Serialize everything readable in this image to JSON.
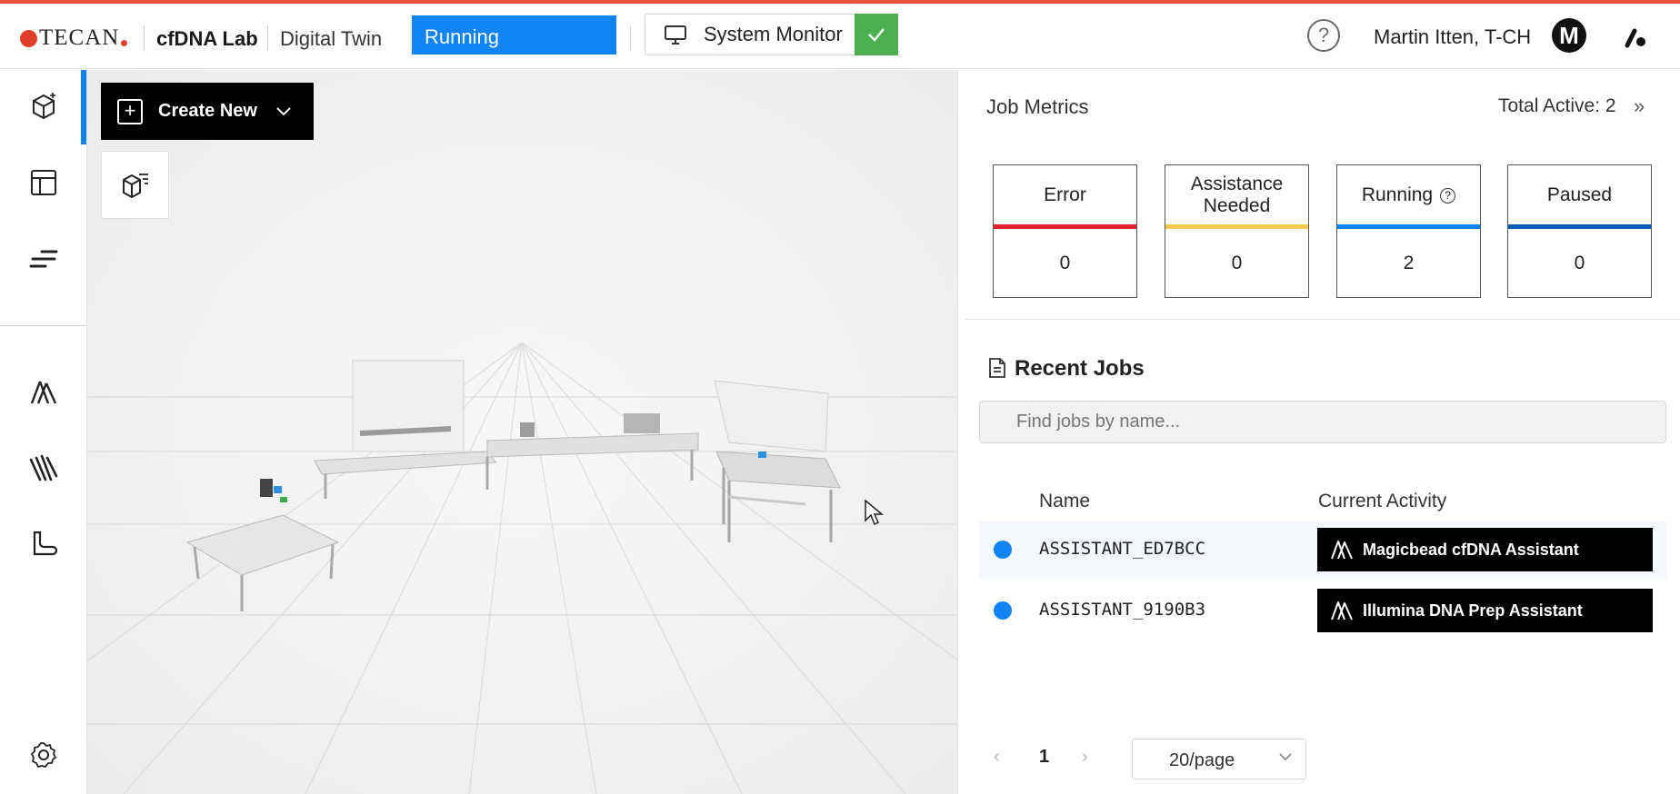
{
  "header": {
    "logo_text": "TECAN",
    "lab_name": "cfDNA Lab",
    "view_name": "Digital Twin",
    "status": "Running",
    "system_monitor_label": "System Monitor",
    "help_glyph": "?",
    "user_name": "Martin Itten, T-CH",
    "avatar_initial": "M"
  },
  "sidebar": {
    "items": [
      {
        "icon": "cube-sparkle-icon"
      },
      {
        "icon": "layout-icon"
      },
      {
        "icon": "lines-icon"
      },
      {
        "icon": "assistant-logo-icon"
      },
      {
        "icon": "wave-lines-icon"
      },
      {
        "icon": "boot-icon"
      },
      {
        "icon": "gear-icon"
      }
    ]
  },
  "toolbar": {
    "create_new_label": "Create New"
  },
  "metrics": {
    "title": "Job Metrics",
    "total_active": "Total Active: 2",
    "cards": [
      {
        "label": "Error",
        "value": "0",
        "color": "#e0242f"
      },
      {
        "label": "Assistance Needed",
        "value": "0",
        "color": "#f2c94c"
      },
      {
        "label": "Running",
        "value": "2",
        "color": "#1083f5"
      },
      {
        "label": "Paused",
        "value": "0",
        "color": "#0b5cb8"
      }
    ]
  },
  "recent_jobs": {
    "title": "Recent Jobs",
    "search_placeholder": "Find jobs by name...",
    "columns": {
      "name": "Name",
      "activity": "Current Activity"
    },
    "rows": [
      {
        "name": "ASSISTANT_ED7BCC",
        "activity": "Magicbead cfDNA Assistant",
        "status_color": "#1083f5"
      },
      {
        "name": "ASSISTANT_9190B3",
        "activity": "Illumina DNA Prep Assistant",
        "status_color": "#1083f5"
      }
    ]
  },
  "pagination": {
    "prev": "‹",
    "page": "1",
    "next": "›",
    "page_size": "20/page"
  },
  "colors": {
    "accent": "#1083f5",
    "success": "#4caf50",
    "brand_red": "#e0402a"
  }
}
